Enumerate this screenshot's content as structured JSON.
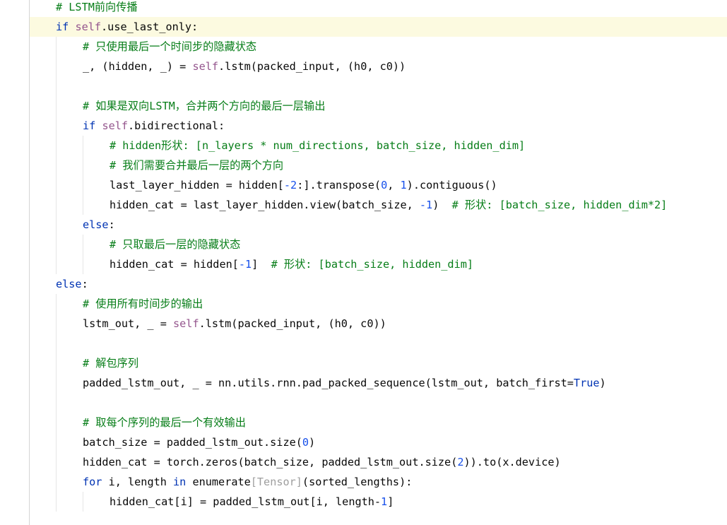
{
  "editor": {
    "lines": [
      {
        "indent": 1,
        "current": false,
        "tokens": [
          {
            "t": "# LSTM前向传播",
            "c": "cm-green"
          }
        ]
      },
      {
        "indent": 1,
        "current": true,
        "tokens": [
          {
            "t": "if",
            "c": "kw"
          },
          {
            "t": " ",
            "c": ""
          },
          {
            "t": "self",
            "c": "slf"
          },
          {
            "t": ".use_last_only:",
            "c": ""
          }
        ]
      },
      {
        "indent": 2,
        "current": false,
        "tokens": [
          {
            "t": "# 只使用最后一个时间步的隐藏状态",
            "c": "cm-green"
          }
        ]
      },
      {
        "indent": 2,
        "current": false,
        "tokens": [
          {
            "t": "_, (hidden, _) = ",
            "c": ""
          },
          {
            "t": "self",
            "c": "slf"
          },
          {
            "t": ".lstm(packed_input, (h0, c0))",
            "c": ""
          }
        ]
      },
      {
        "indent": 2,
        "current": false,
        "tokens": []
      },
      {
        "indent": 2,
        "current": false,
        "tokens": [
          {
            "t": "# 如果是双向LSTM，合并两个方向的最后一层输出",
            "c": "cm-green"
          }
        ]
      },
      {
        "indent": 2,
        "current": false,
        "tokens": [
          {
            "t": "if",
            "c": "kw"
          },
          {
            "t": " ",
            "c": ""
          },
          {
            "t": "self",
            "c": "slf"
          },
          {
            "t": ".bidirectional:",
            "c": ""
          }
        ]
      },
      {
        "indent": 3,
        "current": false,
        "tokens": [
          {
            "t": "# hidden形状: [n_layers * num_directions, batch_size, hidden_dim]",
            "c": "cm-green"
          }
        ]
      },
      {
        "indent": 3,
        "current": false,
        "tokens": [
          {
            "t": "# 我们需要合并最后一层的两个方向",
            "c": "cm-green"
          }
        ]
      },
      {
        "indent": 3,
        "current": false,
        "tokens": [
          {
            "t": "last_layer_hidden = hidden[",
            "c": ""
          },
          {
            "t": "-2",
            "c": "num"
          },
          {
            "t": ":].transpose(",
            "c": ""
          },
          {
            "t": "0",
            "c": "num"
          },
          {
            "t": ", ",
            "c": ""
          },
          {
            "t": "1",
            "c": "num"
          },
          {
            "t": ").contiguous()",
            "c": ""
          }
        ]
      },
      {
        "indent": 3,
        "current": false,
        "tokens": [
          {
            "t": "hidden_cat = last_layer_hidden.view(batch_size, ",
            "c": ""
          },
          {
            "t": "-1",
            "c": "num"
          },
          {
            "t": ")  ",
            "c": ""
          },
          {
            "t": "# 形状: [batch_size, hidden_dim*2]",
            "c": "cm-green"
          }
        ]
      },
      {
        "indent": 2,
        "current": false,
        "tokens": [
          {
            "t": "else",
            "c": "kw"
          },
          {
            "t": ":",
            "c": ""
          }
        ]
      },
      {
        "indent": 3,
        "current": false,
        "tokens": [
          {
            "t": "# 只取最后一层的隐藏状态",
            "c": "cm-green"
          }
        ]
      },
      {
        "indent": 3,
        "current": false,
        "tokens": [
          {
            "t": "hidden_cat = hidden[",
            "c": ""
          },
          {
            "t": "-1",
            "c": "num"
          },
          {
            "t": "]  ",
            "c": ""
          },
          {
            "t": "# 形状: [batch_size, hidden_dim]",
            "c": "cm-green"
          }
        ]
      },
      {
        "indent": 1,
        "current": false,
        "tokens": [
          {
            "t": "else",
            "c": "kw"
          },
          {
            "t": ":",
            "c": ""
          }
        ]
      },
      {
        "indent": 2,
        "current": false,
        "tokens": [
          {
            "t": "# 使用所有时间步的输出",
            "c": "cm-green"
          }
        ]
      },
      {
        "indent": 2,
        "current": false,
        "tokens": [
          {
            "t": "lstm_out, _ = ",
            "c": ""
          },
          {
            "t": "self",
            "c": "slf"
          },
          {
            "t": ".lstm(packed_input, (h0, c0))",
            "c": ""
          }
        ]
      },
      {
        "indent": 2,
        "current": false,
        "tokens": []
      },
      {
        "indent": 2,
        "current": false,
        "tokens": [
          {
            "t": "# 解包序列",
            "c": "cm-green"
          }
        ]
      },
      {
        "indent": 2,
        "current": false,
        "tokens": [
          {
            "t": "padded_lstm_out, _ = nn.utils.rnn.pad_packed_sequence(lstm_out, batch_first=",
            "c": ""
          },
          {
            "t": "True",
            "c": "kw"
          },
          {
            "t": ")",
            "c": ""
          }
        ]
      },
      {
        "indent": 2,
        "current": false,
        "tokens": []
      },
      {
        "indent": 2,
        "current": false,
        "tokens": [
          {
            "t": "# 取每个序列的最后一个有效输出",
            "c": "cm-green"
          }
        ]
      },
      {
        "indent": 2,
        "current": false,
        "tokens": [
          {
            "t": "batch_size = padded_lstm_out.size(",
            "c": ""
          },
          {
            "t": "0",
            "c": "num"
          },
          {
            "t": ")",
            "c": ""
          }
        ]
      },
      {
        "indent": 2,
        "current": false,
        "tokens": [
          {
            "t": "hidden_cat = torch.zeros(batch_size, padded_lstm_out.size(",
            "c": ""
          },
          {
            "t": "2",
            "c": "num"
          },
          {
            "t": ")).to(x.device)",
            "c": ""
          }
        ]
      },
      {
        "indent": 2,
        "current": false,
        "tokens": [
          {
            "t": "for",
            "c": "kw"
          },
          {
            "t": " i, length ",
            "c": ""
          },
          {
            "t": "in",
            "c": "kw"
          },
          {
            "t": " enumerate",
            "c": ""
          },
          {
            "t": "[Tensor]",
            "c": "hint"
          },
          {
            "t": "(sorted_lengths):",
            "c": ""
          }
        ]
      },
      {
        "indent": 3,
        "current": false,
        "tokens": [
          {
            "t": "hidden_cat[i] = padded_lstm_out[i, length-",
            "c": ""
          },
          {
            "t": "1",
            "c": "num"
          },
          {
            "t": "]",
            "c": ""
          }
        ]
      }
    ]
  }
}
